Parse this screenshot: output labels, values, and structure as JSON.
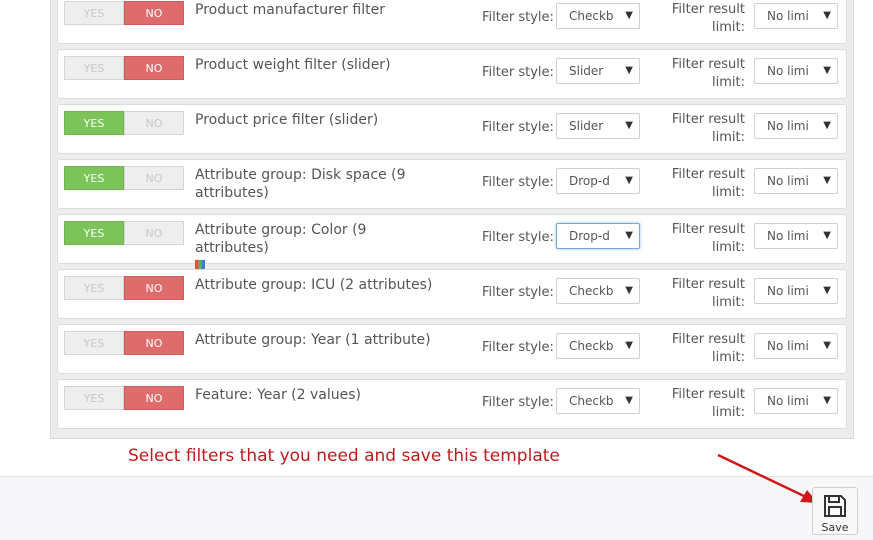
{
  "filters": [
    {
      "label": "Product manufacturer filter",
      "yes": "YES",
      "no": "NO",
      "enabled": false,
      "filter_style_label": "Filter style:",
      "filter_style": "Checkb",
      "limit_label": "Filter result limit:",
      "limit": "No limi"
    },
    {
      "label": "Product weight filter (slider)",
      "yes": "YES",
      "no": "NO",
      "enabled": false,
      "filter_style_label": "Filter style:",
      "filter_style": "Slider",
      "limit_label": "Filter result limit:",
      "limit": "No limi"
    },
    {
      "label": "Product price filter (slider)",
      "yes": "YES",
      "no": "NO",
      "enabled": true,
      "filter_style_label": "Filter style:",
      "filter_style": "Slider",
      "limit_label": "Filter result limit:",
      "limit": "No limi"
    },
    {
      "label": "Attribute group: Disk space (9 attributes)",
      "yes": "YES",
      "no": "NO",
      "enabled": true,
      "filter_style_label": "Filter style:",
      "filter_style": "Drop-d",
      "limit_label": "Filter result limit:",
      "limit": "No limi"
    },
    {
      "label": "Attribute group: Color (9 attributes)",
      "yes": "YES",
      "no": "NO",
      "enabled": true,
      "filter_style_label": "Filter style:",
      "filter_style": "Drop-d",
      "limit_label": "Filter result limit:",
      "limit": "No limi"
    },
    {
      "label": "Attribute group: ICU (2 attributes)",
      "yes": "YES",
      "no": "NO",
      "enabled": false,
      "filter_style_label": "Filter style:",
      "filter_style": "Checkb",
      "limit_label": "Filter result limit:",
      "limit": "No limi"
    },
    {
      "label": "Attribute group: Year (1 attribute)",
      "yes": "YES",
      "no": "NO",
      "enabled": false,
      "filter_style_label": "Filter style:",
      "filter_style": "Checkb",
      "limit_label": "Filter result limit:",
      "limit": "No limi"
    },
    {
      "label": "Feature: Year (2 values)",
      "yes": "YES",
      "no": "NO",
      "enabled": false,
      "filter_style_label": "Filter style:",
      "filter_style": "Checkb",
      "limit_label": "Filter result limit:",
      "limit": "No limi"
    }
  ],
  "annotation": "Select filters that you need and save this template",
  "save_label": "Save",
  "icons": {
    "dropdown": "caret-down-icon",
    "save": "floppy-disk-icon",
    "color": "color-palette-icon",
    "pointer": "red-arrow-icon"
  },
  "colors": {
    "yes_active": "#7cc359",
    "no_active": "#df6c6c",
    "annotation": "#c21a1a"
  }
}
